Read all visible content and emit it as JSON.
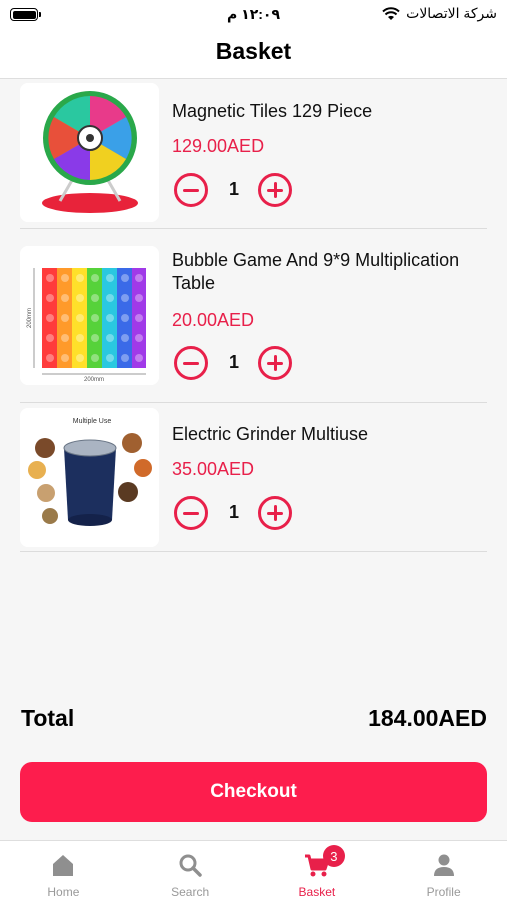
{
  "status_bar": {
    "time": "١٢:٠٩ م",
    "carrier": "شركة الاتصالات"
  },
  "header": {
    "title": "Basket"
  },
  "items": [
    {
      "name": "Magnetic Tiles 129 Piece",
      "price": "129.00AED",
      "quantity": "1",
      "thumb_icon": "magnetic-tiles-wheel"
    },
    {
      "name": "Bubble Game And 9*9 Multiplication Table",
      "price": "20.00AED",
      "quantity": "1",
      "thumb_icon": "rainbow-pop-board",
      "thumb_labels": {
        "width": "200mm",
        "height": "200mm"
      }
    },
    {
      "name": "Electric Grinder Multiuse",
      "price": "35.00AED",
      "quantity": "1",
      "thumb_icon": "electric-grinder",
      "thumb_labels": {
        "title": "Multiple Use"
      }
    }
  ],
  "summary": {
    "total_label": "Total",
    "total_value": "184.00AED"
  },
  "checkout": {
    "label": "Checkout"
  },
  "tabbar": {
    "tabs": [
      {
        "label": "Home",
        "icon": "home-icon"
      },
      {
        "label": "Search",
        "icon": "search-icon"
      },
      {
        "label": "Basket",
        "icon": "cart-icon",
        "badge": "3",
        "active": true
      },
      {
        "label": "Profile",
        "icon": "person-icon"
      }
    ]
  },
  "colors": {
    "accent": "#e8204a",
    "button": "#fd1d4d",
    "inactive": "#999999"
  }
}
